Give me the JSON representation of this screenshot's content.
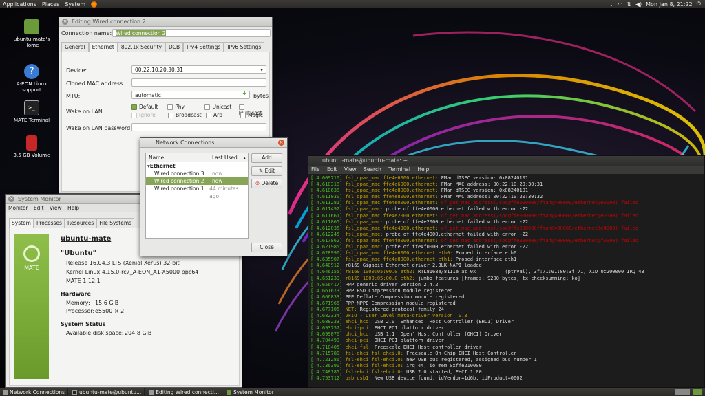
{
  "top_panel": {
    "menus": [
      "Applications",
      "Places",
      "System"
    ],
    "clock": "Mon Jan 8, 21:22"
  },
  "desktop_icons": [
    {
      "label": "ubuntu-mate's Home",
      "icon": "home-folder-icon"
    },
    {
      "label": "A-EON Linux support",
      "icon": "help-icon"
    },
    {
      "label": "MATE Terminal",
      "icon": "terminal-icon"
    },
    {
      "label": "3.5 GB Volume",
      "icon": "sd-card-icon"
    }
  ],
  "edit_conn": {
    "title": "Editing Wired connection 2",
    "name_label": "Connection name:",
    "name_value": "Wired connection 2",
    "tabs": [
      "General",
      "Ethernet",
      "802.1x Security",
      "DCB",
      "IPv4 Settings",
      "IPv6 Settings"
    ],
    "device_label": "Device:",
    "device_value": "00:22:10:20:30:31",
    "cloned_label": "Cloned MAC address:",
    "mtu_label": "MTU:",
    "mtu_value": "automatic",
    "mtu_unit": "bytes",
    "wol_label": "Wake on LAN:",
    "wol_opts": [
      "Default",
      "Phy",
      "Unicast",
      "Multicast",
      "Ignore",
      "Broadcast",
      "Arp",
      "Magic"
    ],
    "wolpw_label": "Wake on LAN password:"
  },
  "netconn": {
    "title": "Network Connections",
    "col_name": "Name",
    "col_last": "Last Used",
    "group": "Ethernet",
    "rows": [
      {
        "name": "Wired connection 3",
        "last": "now"
      },
      {
        "name": "Wired connection 2",
        "last": "now"
      },
      {
        "name": "Wired connection 1",
        "last": "44 minutes ago"
      }
    ],
    "add": "Add",
    "edit": "Edit",
    "delete": "Delete",
    "close": "Close"
  },
  "sysmon": {
    "title": "System Monitor",
    "menu": [
      "Monitor",
      "Edit",
      "View",
      "Help"
    ],
    "tabs": [
      "System",
      "Processes",
      "Resources",
      "File Systems"
    ],
    "logo_text": "MATE",
    "hostname": "ubuntu-mate",
    "distro": "\"Ubuntu\"",
    "release": "Release 16.04.3 LTS (Xenial Xerus) 32-bit",
    "kernel": "Kernel Linux 4.15.0-rc7_A-EON_A1-X5000 ppc64",
    "mate": "MATE 1.12.1",
    "hw_head": "Hardware",
    "memory": "Memory:",
    "memory_v": "15.6 GiB",
    "proc": "Processor:",
    "proc_v": "e5500 × 2",
    "status_head": "System Status",
    "disk": "Available disk space:",
    "disk_v": "204.8 GiB"
  },
  "terminal": {
    "title": "ubuntu-mate@ubuntu-mate: ~",
    "menu": [
      "File",
      "Edit",
      "View",
      "Search",
      "Terminal",
      "Help"
    ],
    "lines": [
      {
        "t": "4.609710",
        "m": "fsl_dpaa_mac ffe4e6000.ethernet:",
        "r": " FMan dTSEC version: 0x08240101",
        "c": "tm"
      },
      {
        "t": "4.610318",
        "m": "fsl_dpaa_mac ffe4e6000.ethernet:",
        "r": " FMan MAC address: 00:22:10:20:30:31",
        "c": "tm"
      },
      {
        "t": "4.610638",
        "m": "fsl_dpaa_mac ffe4e8000.ethernet:",
        "r": " FMan dTSEC version: 0x08240101",
        "c": "tm"
      },
      {
        "t": "4.611030",
        "m": "fsl_dpaa_mac ffe4e8000.ethernet:",
        "r": " FMan MAC address: 00:22:10:20:30:32",
        "c": "tm"
      },
      {
        "t": "4.611281",
        "m": "fsl_dpaa_mac ffe4e0000.ethernet:",
        "r": " of_get_mac_address(/soc@ffe000000/fman@400000/ethernet@e0000) failed",
        "c": "tr"
      },
      {
        "t": "4.611492",
        "m": "fsl_dpaa_mac:",
        "r": " probe of ffe4e0000.ethernet failed with error -22",
        "c": "tm"
      },
      {
        "t": "4.611661",
        "m": "fsl_dpaa_mac ffe4e2000.ethernet:",
        "r": " of_get_mac_address(/soc@ffe000000/fman@400000/ethernet@e2000) failed",
        "c": "tr"
      },
      {
        "t": "4.611865",
        "m": "fsl_dpaa_mac:",
        "r": " probe of ffe4e2000.ethernet failed with error -22",
        "c": "tm"
      },
      {
        "t": "4.612035",
        "m": "fsl_dpaa_mac ffe4e4000.ethernet:",
        "r": " of_get_mac_address(/soc@ffe000000/fman@400000/ethernet@e4000) failed",
        "c": "tr"
      },
      {
        "t": "4.612245",
        "m": "fsl_dpaa_mac:",
        "r": " probe of ffe4e4000.ethernet failed with error -22",
        "c": "tm"
      },
      {
        "t": "4.617862",
        "m": "fsl_dpaa_mac ffe4f0000.ethernet:",
        "r": " of_get_mac_address(/soc@ffe000000/fman@400000/ethernet@f0000) failed",
        "c": "tr"
      },
      {
        "t": "4.621985",
        "m": "fsl_dpaa_mac:",
        "r": " probe of ffe4f0000.ethernet failed with error -22",
        "c": "tm"
      },
      {
        "t": "4.628996",
        "m": "fsl_dpaa_mac ffe4e6000.ethernet eth0:",
        "r": " Probed interface eth0",
        "c": "tm"
      },
      {
        "t": "4.635907",
        "m": "fsl_dpaa_mac ffe4e8000.ethernet eth1:",
        "r": " Probed interface eth1",
        "c": "tm"
      },
      {
        "t": "4.640912",
        "m": "",
        "r": "r8169 Gigabit Ethernet driver 2.3LK-NAPI loaded",
        "c": "tm"
      },
      {
        "t": "4.646155",
        "m": "r8169 1000:05:00.0 eth2:",
        "r": " RTL8168e/8111e at 0x          (ptrval), 3f:71:01:80:3f:71, XID 0c200000 IRQ 43",
        "c": "tm"
      },
      {
        "t": "4.651239",
        "m": "r8169 1000:05:00.0 eth2:",
        "r": " jumbo features [frames: 9200 bytes, tx checksumming: ko]",
        "c": "tm"
      },
      {
        "t": "4.656417",
        "m": "",
        "r": "PPP generic driver version 2.4.2",
        "c": "tm"
      },
      {
        "t": "4.661673",
        "m": "",
        "r": "PPP BSD Compression module registered",
        "c": "tm"
      },
      {
        "t": "4.666833",
        "m": "",
        "r": "PPP Deflate Compression module registered",
        "c": "tm"
      },
      {
        "t": "4.671965",
        "m": "",
        "r": "PPP MPPE Compression module registered",
        "c": "tm"
      },
      {
        "t": "4.677105",
        "m": "NET:",
        "r": " Registered protocol family 24",
        "c": "tm"
      },
      {
        "t": "4.682334",
        "m": "VFIO - User Level meta-driver version: 0.3",
        "r": "",
        "c": "tm"
      },
      {
        "t": "4.688233",
        "m": "ehci_hcd:",
        "r": " USB 2.0 'Enhanced' Host Controller (EHCI) Driver",
        "c": "tm"
      },
      {
        "t": "4.693757",
        "m": "ehci-pci:",
        "r": " EHCI PCI platform driver",
        "c": "tm"
      },
      {
        "t": "4.699070",
        "m": "ohci_hcd:",
        "r": " USB 1.1 'Open' Host Controller (OHCI) Driver",
        "c": "tm"
      },
      {
        "t": "4.704499",
        "m": "ohci-pci:",
        "r": " OHCI PCI platform driver",
        "c": "tm"
      },
      {
        "t": "4.710405",
        "m": "ehci-fsl:",
        "r": " Freescale EHCI Host controller driver",
        "c": "tm"
      },
      {
        "t": "4.715780",
        "m": "fsl-ehci fsl-ehci.0:",
        "r": " Freescale On-Chip EHCI Host Controller",
        "c": "tm"
      },
      {
        "t": "4.721286",
        "m": "fsl-ehci fsl-ehci.0:",
        "r": " new USB bus registered, assigned bus number 1",
        "c": "tm"
      },
      {
        "t": "4.736390",
        "m": "fsl-ehci fsl-ehci.0:",
        "r": " irq 44, io mem 0xffe210000",
        "c": "tm"
      },
      {
        "t": "4.748185",
        "m": "fsl-ehci fsl-ehci.0:",
        "r": " USB 2.0 started, EHCI 1.00",
        "c": "tm"
      },
      {
        "t": "4.753712",
        "m": "usb usb1:",
        "r": " New USB device found, idVendor=1d6b, idProduct=0002",
        "c": "tm"
      }
    ]
  },
  "taskbar": {
    "items": [
      "Network Connections",
      "ubuntu-mate@ubuntu...",
      "Editing Wired connecti...",
      "System Monitor"
    ]
  }
}
